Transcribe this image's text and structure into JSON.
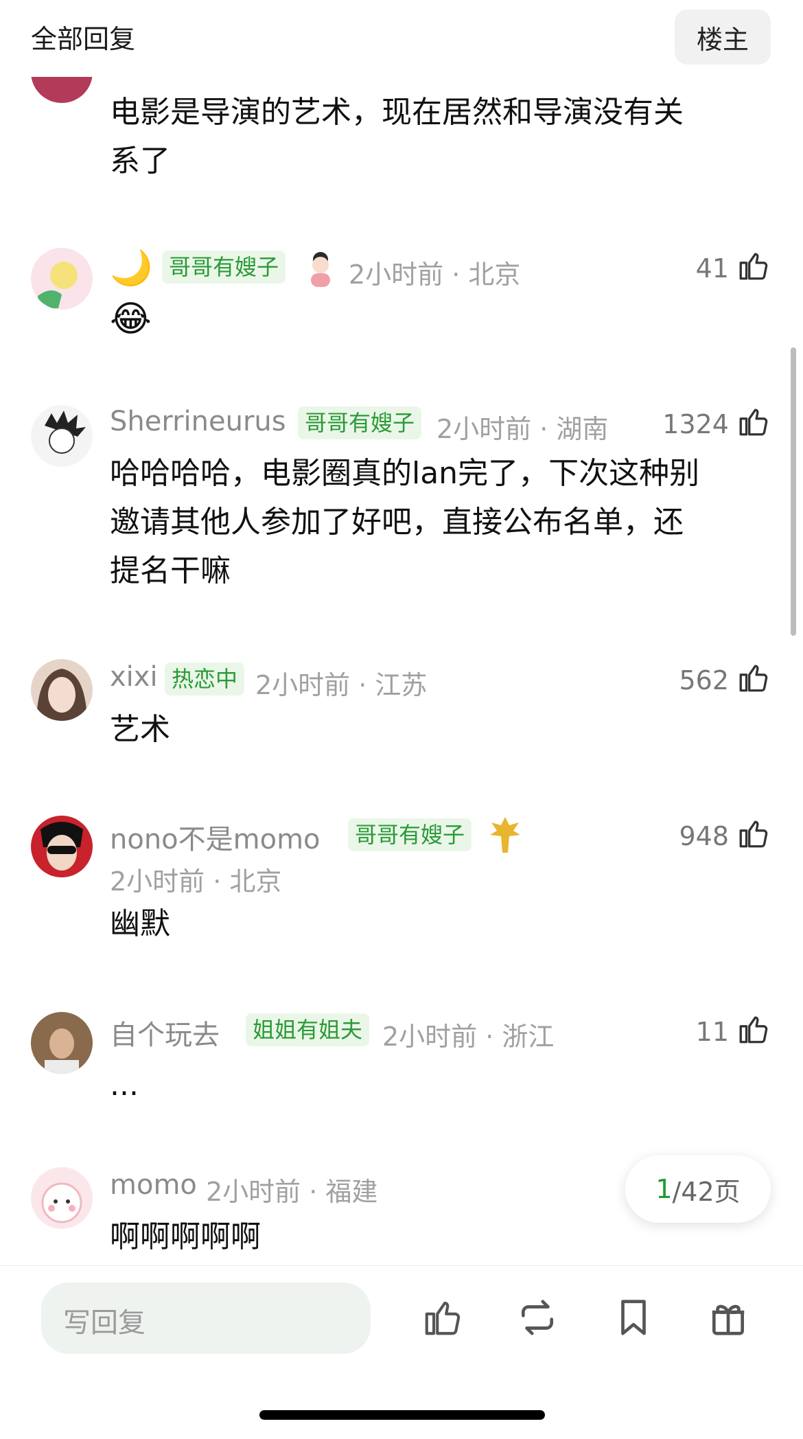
{
  "header": {
    "title": "全部回复",
    "owner_button": "楼主"
  },
  "comments": [
    {
      "text_lines": [
        "电影是导演的艺术，现在居然和导演没有关",
        "系了"
      ]
    },
    {
      "name": "🌙",
      "badge": "哥哥有嫂子",
      "time": "2小时前 · 北京",
      "likes": "41",
      "text_lines": [
        "😂"
      ]
    },
    {
      "name": "Sherrineurus",
      "badge": "哥哥有嫂子",
      "time": "2小时前 · 湖南",
      "likes": "1324",
      "text_lines": [
        "哈哈哈哈，电影圈真的lan完了，下次这种别",
        "邀请其他人参加了好吧，直接公布名单，还",
        "提名干嘛"
      ]
    },
    {
      "name": "xixi",
      "badge": "热恋中",
      "time": "2小时前 · 江苏",
      "likes": "562",
      "text_lines": [
        "艺术"
      ]
    },
    {
      "name": "nono不是momo",
      "badge": "哥哥有嫂子",
      "time": "2小时前 · 北京",
      "likes": "948",
      "text_lines": [
        "幽默"
      ]
    },
    {
      "name": "自个玩去",
      "badge": "姐姐有姐夫",
      "time": "2小时前 · 浙江",
      "likes": "11",
      "text_lines": [
        "..."
      ]
    },
    {
      "name": "momo",
      "time": "2小时前 · 福建",
      "text_lines": [
        "啊啊啊啊啊"
      ]
    }
  ],
  "pager": {
    "current": "1",
    "total": "/42页"
  },
  "bottom_bar": {
    "reply_placeholder": "写回复"
  },
  "colors": {
    "badge_bg": "#eaf7e8",
    "badge_text": "#2a9a36",
    "accent": "#1f9a35"
  }
}
